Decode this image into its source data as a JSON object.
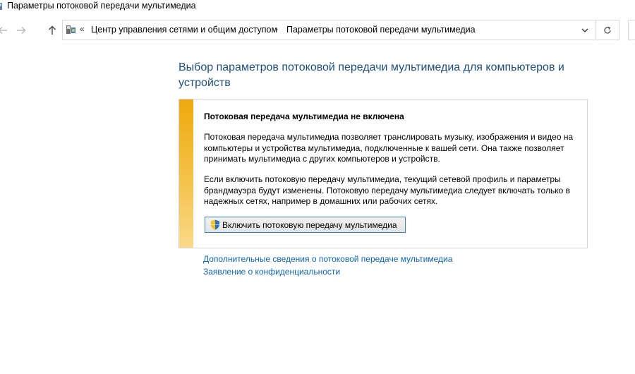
{
  "window": {
    "title": "Параметры потоковой передачи мультимедиа"
  },
  "navigation": {
    "back_icon": "arrow-left-icon",
    "forward_icon": "arrow-right-icon",
    "up_icon": "arrow-up-icon",
    "address": {
      "icon": "control-panel-icon",
      "overflow_glyph": "«",
      "breadcrumbs": [
        "Центр управления сетями и общим доступом",
        "Параметры потоковой передачи мультимедиа"
      ],
      "separator": "›"
    },
    "dropdown_icon": "chevron-down-icon",
    "refresh_icon": "refresh-icon"
  },
  "main": {
    "heading": "Выбор параметров потоковой передачи мультимедиа для компьютеров и устройств",
    "notice": {
      "accent_color": "#efa90e",
      "title": "Потоковая передача мультимедиа не включена",
      "paragraph1": "Потоковая передача мультимедиа позволяет транслировать музыку, изображения и видео на компьютеры и устройства мультимедиа, подключенные к вашей сети. Она также позволяет принимать мультимедиа с других компьютеров и устройств.",
      "paragraph2": "Если включить потоковую передачу мультимедиа, текущий сетевой профиль и параметры брандмауэра будут изменены. Потоковую передачу мультимедиа следует включать только в надежных сетях, например в домашних или рабочих сетях.",
      "button_label": "Включить потоковую передачу мультимедиа",
      "button_icon": "uac-shield-icon"
    },
    "links": [
      "Дополнительные сведения о потоковой передаче мультимедиа",
      "Заявление о конфиденциальности"
    ]
  }
}
